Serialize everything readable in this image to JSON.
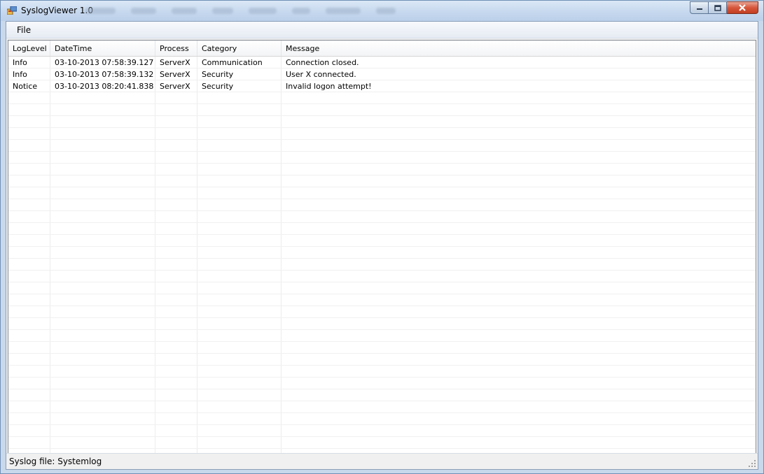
{
  "window": {
    "title": "SyslogViewer 1.0",
    "icon": "app-icon",
    "minimize_icon": "minimize-icon",
    "maximize_icon": "maximize-icon",
    "close_icon": "close-icon"
  },
  "menu": {
    "file_label": "File"
  },
  "log_table": {
    "columns": [
      "LogLevel",
      "DateTime",
      "Process",
      "Category",
      "Message"
    ],
    "rows": [
      [
        "Info",
        "03-10-2013 07:58:39.127",
        "ServerX",
        "Communication",
        "Connection closed."
      ],
      [
        "Info",
        "03-10-2013 07:58:39.132",
        "ServerX",
        "Security",
        "User X connected."
      ],
      [
        "Notice",
        "03-10-2013 08:20:41.838",
        "ServerX",
        "Security",
        "Invalid logon attempt!"
      ]
    ]
  },
  "status": {
    "text": "Syslog file:  Systemlog"
  },
  "colors": {
    "title_bar": "#c5d7ee",
    "close_button": "#d6573c",
    "client_background": "#f0f0f0"
  }
}
